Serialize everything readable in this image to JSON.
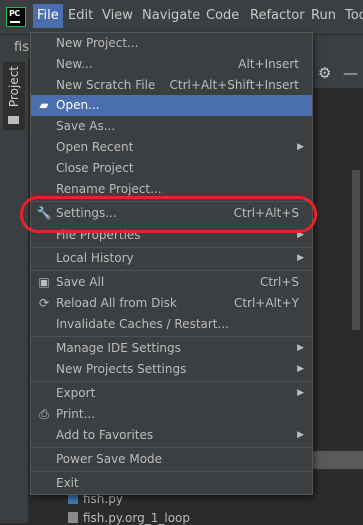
{
  "menubar": {
    "logo_text": "PC",
    "items": [
      "File",
      "Edit",
      "View",
      "Navigate",
      "Code",
      "Refactor",
      "Run",
      "Too"
    ]
  },
  "editor": {
    "breadcrumb": "fish",
    "project_tab": "Project"
  },
  "file_menu": [
    {
      "label": "New Project...",
      "shortcut": ""
    },
    {
      "label": "New...",
      "shortcut": "Alt+Insert"
    },
    {
      "label": "New Scratch File",
      "shortcut": "Ctrl+Alt+Shift+Insert"
    },
    {
      "label": "Open...",
      "shortcut": "",
      "icon": "folder-icon",
      "highlighted": true
    },
    {
      "label": "Save As...",
      "shortcut": ""
    },
    {
      "label": "Open Recent",
      "shortcut": "",
      "submenu": true
    },
    {
      "label": "Close Project",
      "shortcut": ""
    },
    {
      "label": "Rename Project...",
      "shortcut": ""
    },
    {
      "label": "Settings...",
      "shortcut": "Ctrl+Alt+S",
      "icon": "wrench-icon"
    },
    {
      "label": "File Properties",
      "shortcut": "",
      "submenu": true
    },
    {
      "label": "Local History",
      "shortcut": "",
      "submenu": true
    },
    {
      "label": "Save All",
      "shortcut": "Ctrl+S",
      "icon": "floppy-disk-icon"
    },
    {
      "label": "Reload All from Disk",
      "shortcut": "Ctrl+Alt+Y",
      "icon": "reload-icon"
    },
    {
      "label": "Invalidate Caches / Restart...",
      "shortcut": ""
    },
    {
      "label": "Manage IDE Settings",
      "shortcut": "",
      "submenu": true
    },
    {
      "label": "New Projects Settings",
      "shortcut": "",
      "submenu": true
    },
    {
      "label": "Export",
      "shortcut": "",
      "submenu": true
    },
    {
      "label": "Print...",
      "shortcut": "",
      "icon": "printer-icon"
    },
    {
      "label": "Add to Favorites",
      "shortcut": "",
      "submenu": true
    },
    {
      "label": "Power Save Mode",
      "shortcut": ""
    },
    {
      "label": "Exit",
      "shortcut": ""
    }
  ],
  "project_tree": [
    {
      "label": "fish.py"
    },
    {
      "label": "fish.py.org_1_loop"
    }
  ],
  "colors": {
    "highlight": "#4b6eaf",
    "menu_bg": "#3c3f41",
    "annotation_red": "#e8222a"
  }
}
